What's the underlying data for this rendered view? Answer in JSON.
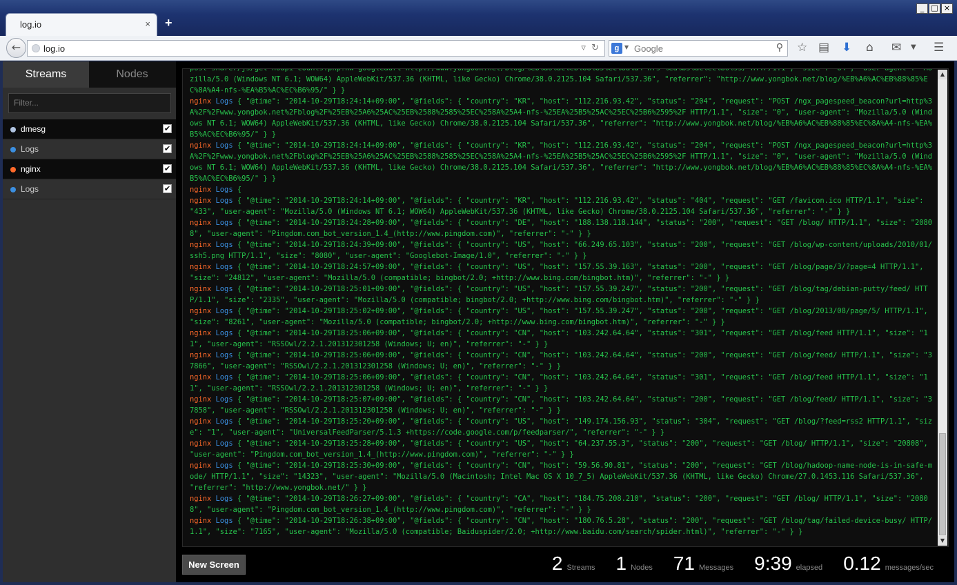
{
  "browser": {
    "tab_title": "log.io",
    "tab_close": "×",
    "new_tab": "+",
    "url": "log.io",
    "search_placeholder": "Google",
    "window_buttons": [
      "_",
      "□",
      "×"
    ]
  },
  "sidebar": {
    "tabs": [
      {
        "label": "Streams",
        "active": true
      },
      {
        "label": "Nodes",
        "active": false
      }
    ],
    "filter_placeholder": "Filter...",
    "streams": [
      {
        "label": "dmesg",
        "type": "group",
        "color": "#b0c4e0",
        "checked": true
      },
      {
        "label": "Logs",
        "type": "child",
        "color": "#3b8fe0",
        "checked": true
      },
      {
        "label": "nginx",
        "type": "group",
        "color": "#ff6a2a",
        "checked": true
      },
      {
        "label": "Logs",
        "type": "child",
        "color": "#3b8fe0",
        "checked": true
      }
    ]
  },
  "log": {
    "lines": [
      {
        "stream": "",
        "node": "",
        "text": "post-sharer/js/get-noapi-counts.php?nw=google&url=http://www.yongbok.net/blog/%eb%a6%ac%eb%88%85%ec%8a%a4-nfs-%ea%b5%ac%ec%b6%95/ HTTP/1.1\", \"size\": \"84\", \"user-agent\": \"Mozilla/5.0 (Windows NT 6.1; WOW64) AppleWebKit/537.36 (KHTML, like Gecko) Chrome/38.0.2125.104 Safari/537.36\", \"referrer\": \"http://www.yongbok.net/blog/%EB%A6%AC%EB%88%85%EC%8A%A4-nfs-%EA%B5%AC%EC%B6%95/\" } }"
      },
      {
        "stream": "nginx",
        "node": "Logs",
        "text": "{ \"@time\": \"2014-10-29T18:24:14+09:00\", \"@fields\": { \"country\": \"KR\", \"host\": \"112.216.93.42\", \"status\": \"204\", \"request\": \"POST /ngx_pagespeed_beacon?url=http%3A%2F%2Fwww.yongbok.net%2Fblog%2F%25EB%25A6%25AC%25EB%2588%2585%25EC%258A%25A4-nfs-%25EA%25B5%25AC%25EC%25B6%2595%2F HTTP/1.1\", \"size\": \"0\", \"user-agent\": \"Mozilla/5.0 (Windows NT 6.1; WOW64) AppleWebKit/537.36 (KHTML, like Gecko) Chrome/38.0.2125.104 Safari/537.36\", \"referrer\": \"http://www.yongbok.net/blog/%EB%A6%AC%EB%88%85%EC%8A%A4-nfs-%EA%B5%AC%EC%B6%95/\" } }"
      },
      {
        "stream": "nginx",
        "node": "Logs",
        "text": "{ \"@time\": \"2014-10-29T18:24:14+09:00\", \"@fields\": { \"country\": \"KR\", \"host\": \"112.216.93.42\", \"status\": \"204\", \"request\": \"POST /ngx_pagespeed_beacon?url=http%3A%2F%2Fwww.yongbok.net%2Fblog%2F%25EB%25A6%25AC%25EB%2588%2585%25EC%258A%25A4-nfs-%25EA%25B5%25AC%25EC%25B6%2595%2F HTTP/1.1\", \"size\": \"0\", \"user-agent\": \"Mozilla/5.0 (Windows NT 6.1; WOW64) AppleWebKit/537.36 (KHTML, like Gecko) Chrome/38.0.2125.104 Safari/537.36\", \"referrer\": \"http://www.yongbok.net/blog/%EB%A6%AC%EB%88%85%EC%8A%A4-nfs-%EA%B5%AC%EC%B6%95/\" } }"
      },
      {
        "stream": "nginx",
        "node": "Logs",
        "text": "{"
      },
      {
        "stream": "nginx",
        "node": "Logs",
        "text": "{ \"@time\": \"2014-10-29T18:24:14+09:00\", \"@fields\": { \"country\": \"KR\", \"host\": \"112.216.93.42\", \"status\": \"404\", \"request\": \"GET /favicon.ico HTTP/1.1\", \"size\": \"433\", \"user-agent\": \"Mozilla/5.0 (Windows NT 6.1; WOW64) AppleWebKit/537.36 (KHTML, like Gecko) Chrome/38.0.2125.104 Safari/537.36\", \"referrer\": \"-\" } }"
      },
      {
        "stream": "nginx",
        "node": "Logs",
        "text": "{ \"@time\": \"2014-10-29T18:24:28+09:00\", \"@fields\": { \"country\": \"DE\", \"host\": \"188.138.118.144\", \"status\": \"200\", \"request\": \"GET /blog/ HTTP/1.1\", \"size\": \"20808\", \"user-agent\": \"Pingdom.com_bot_version_1.4_(http://www.pingdom.com)\", \"referrer\": \"-\" } }"
      },
      {
        "stream": "nginx",
        "node": "Logs",
        "text": "{ \"@time\": \"2014-10-29T18:24:39+09:00\", \"@fields\": { \"country\": \"US\", \"host\": \"66.249.65.103\", \"status\": \"200\", \"request\": \"GET /blog/wp-content/uploads/2010/01/ssh5.png HTTP/1.1\", \"size\": \"8080\", \"user-agent\": \"Googlebot-Image/1.0\", \"referrer\": \"-\" } }"
      },
      {
        "stream": "nginx",
        "node": "Logs",
        "text": "{ \"@time\": \"2014-10-29T18:24:57+09:00\", \"@fields\": { \"country\": \"US\", \"host\": \"157.55.39.163\", \"status\": \"200\", \"request\": \"GET /blog/page/3/?page=4 HTTP/1.1\", \"size\": \"24812\", \"user-agent\": \"Mozilla/5.0 (compatible; bingbot/2.0; +http://www.bing.com/bingbot.htm)\", \"referrer\": \"-\" } }"
      },
      {
        "stream": "nginx",
        "node": "Logs",
        "text": "{ \"@time\": \"2014-10-29T18:25:01+09:00\", \"@fields\": { \"country\": \"US\", \"host\": \"157.55.39.247\", \"status\": \"200\", \"request\": \"GET /blog/tag/debian-putty/feed/ HTTP/1.1\", \"size\": \"2335\", \"user-agent\": \"Mozilla/5.0 (compatible; bingbot/2.0; +http://www.bing.com/bingbot.htm)\", \"referrer\": \"-\" } }"
      },
      {
        "stream": "nginx",
        "node": "Logs",
        "text": "{ \"@time\": \"2014-10-29T18:25:02+09:00\", \"@fields\": { \"country\": \"US\", \"host\": \"157.55.39.247\", \"status\": \"200\", \"request\": \"GET /blog/2013/08/page/5/ HTTP/1.1\", \"size\": \"8261\", \"user-agent\": \"Mozilla/5.0 (compatible; bingbot/2.0; +http://www.bing.com/bingbot.htm)\", \"referrer\": \"-\" } }"
      },
      {
        "stream": "nginx",
        "node": "Logs",
        "text": "{ \"@time\": \"2014-10-29T18:25:06+09:00\", \"@fields\": { \"country\": \"CN\", \"host\": \"103.242.64.64\", \"status\": \"301\", \"request\": \"GET /blog/feed HTTP/1.1\", \"size\": \"11\", \"user-agent\": \"RSSOwl/2.2.1.201312301258 (Windows; U; en)\", \"referrer\": \"-\" } }"
      },
      {
        "stream": "nginx",
        "node": "Logs",
        "text": "{ \"@time\": \"2014-10-29T18:25:06+09:00\", \"@fields\": { \"country\": \"CN\", \"host\": \"103.242.64.64\", \"status\": \"200\", \"request\": \"GET /blog/feed/ HTTP/1.1\", \"size\": \"37866\", \"user-agent\": \"RSSOwl/2.2.1.201312301258 (Windows; U; en)\", \"referrer\": \"-\" } }"
      },
      {
        "stream": "nginx",
        "node": "Logs",
        "text": "{ \"@time\": \"2014-10-29T18:25:06+09:00\", \"@fields\": { \"country\": \"CN\", \"host\": \"103.242.64.64\", \"status\": \"301\", \"request\": \"GET /blog/feed HTTP/1.1\", \"size\": \"11\", \"user-agent\": \"RSSOwl/2.2.1.201312301258 (Windows; U; en)\", \"referrer\": \"-\" } }"
      },
      {
        "stream": "nginx",
        "node": "Logs",
        "text": "{ \"@time\": \"2014-10-29T18:25:07+09:00\", \"@fields\": { \"country\": \"CN\", \"host\": \"103.242.64.64\", \"status\": \"200\", \"request\": \"GET /blog/feed/ HTTP/1.1\", \"size\": \"37858\", \"user-agent\": \"RSSOwl/2.2.1.201312301258 (Windows; U; en)\", \"referrer\": \"-\" } }"
      },
      {
        "stream": "nginx",
        "node": "Logs",
        "text": "{ \"@time\": \"2014-10-29T18:25:20+09:00\", \"@fields\": { \"country\": \"US\", \"host\": \"149.174.156.93\", \"status\": \"304\", \"request\": \"GET /blog/?feed=rss2 HTTP/1.1\", \"size\": \"1\", \"user-agent\": \"UniversalFeedParser/5.1.3 +https://code.google.com/p/feedparser/\", \"referrer\": \"-\" } }"
      },
      {
        "stream": "nginx",
        "node": "Logs",
        "text": "{ \"@time\": \"2014-10-29T18:25:28+09:00\", \"@fields\": { \"country\": \"US\", \"host\": \"64.237.55.3\", \"status\": \"200\", \"request\": \"GET /blog/ HTTP/1.1\", \"size\": \"20808\", \"user-agent\": \"Pingdom.com_bot_version_1.4_(http://www.pingdom.com)\", \"referrer\": \"-\" } }"
      },
      {
        "stream": "nginx",
        "node": "Logs",
        "text": "{ \"@time\": \"2014-10-29T18:25:30+09:00\", \"@fields\": { \"country\": \"CN\", \"host\": \"59.56.90.81\", \"status\": \"200\", \"request\": \"GET /blog/hadoop-name-node-is-in-safe-mode/ HTTP/1.1\", \"size\": \"14323\", \"user-agent\": \"Mozilla/5.0 (Macintosh; Intel Mac OS X 10_7_5) AppleWebKit/537.36 (KHTML, like Gecko) Chrome/27.0.1453.116 Safari/537.36\", \"referrer\": \"http://www.yongbok.net/\" } }"
      },
      {
        "stream": "nginx",
        "node": "Logs",
        "text": "{ \"@time\": \"2014-10-29T18:26:27+09:00\", \"@fields\": { \"country\": \"CA\", \"host\": \"184.75.208.210\", \"status\": \"200\", \"request\": \"GET /blog/ HTTP/1.1\", \"size\": \"20808\", \"user-agent\": \"Pingdom.com_bot_version_1.4_(http://www.pingdom.com)\", \"referrer\": \"-\" } }"
      },
      {
        "stream": "nginx",
        "node": "Logs",
        "text": "{ \"@time\": \"2014-10-29T18:26:38+09:00\", \"@fields\": { \"country\": \"CN\", \"host\": \"180.76.5.28\", \"status\": \"200\", \"request\": \"GET /blog/tag/failed-device-busy/ HTTP/1.1\", \"size\": \"7165\", \"user-agent\": \"Mozilla/5.0 (compatible; Baiduspider/2.0; +http://www.baidu.com/search/spider.html)\", \"referrer\": \"-\" } }"
      }
    ]
  },
  "footer": {
    "new_screen_label": "New Screen",
    "stats": [
      {
        "value": "2",
        "label": "Streams"
      },
      {
        "value": "1",
        "label": "Nodes"
      },
      {
        "value": "71",
        "label": "Messages"
      },
      {
        "value": "9:39",
        "label": "elapsed"
      },
      {
        "value": "0.12",
        "label": "messages/sec"
      }
    ]
  }
}
